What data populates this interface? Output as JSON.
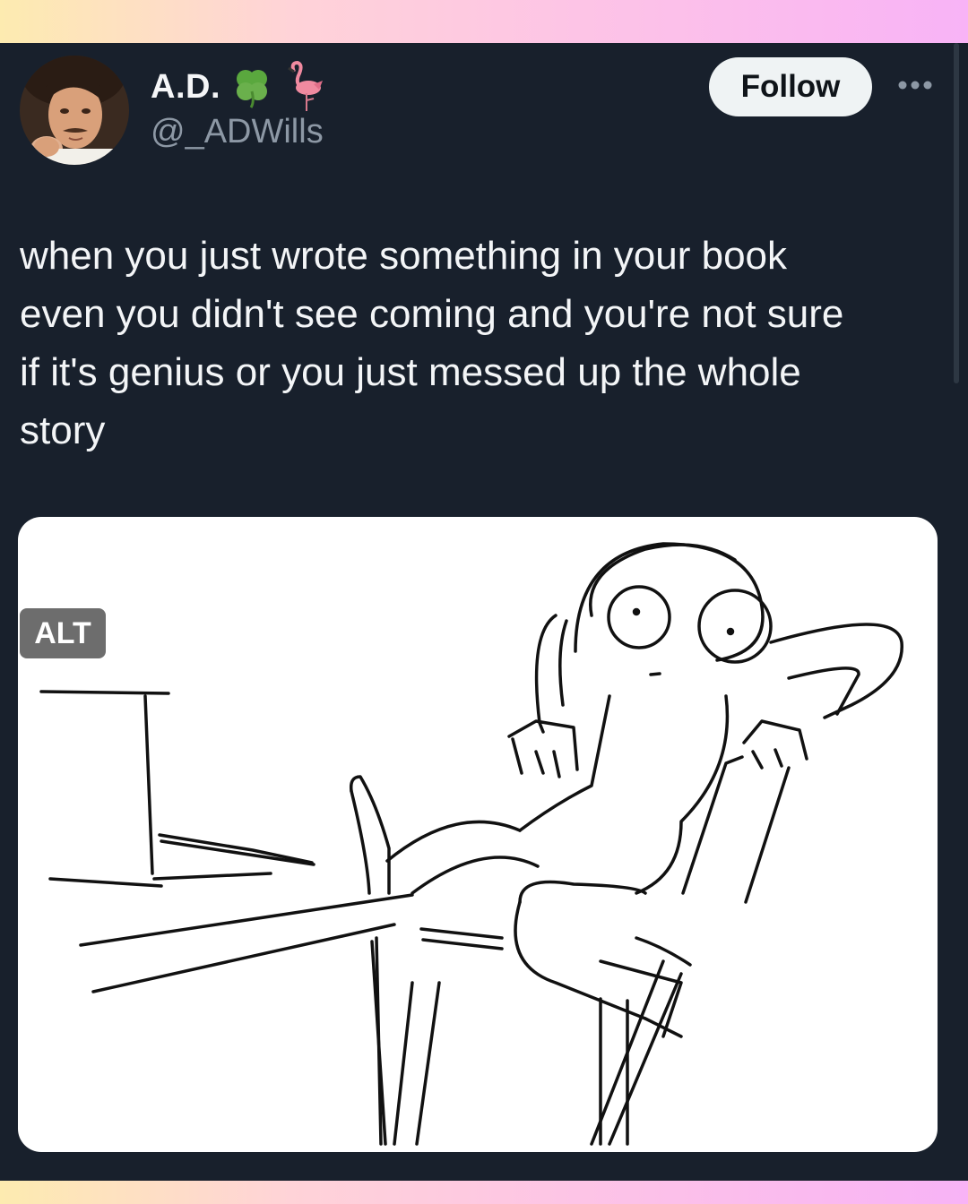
{
  "author": {
    "display_name": "A.D.",
    "handle": "@_ADWills",
    "name_emojis": [
      "clover-icon",
      "flamingo-icon"
    ]
  },
  "follow_label": "Follow",
  "post_text": "when you just wrote something in your book\neven you didn't see coming and you're not sure\nif it's genius or you just messed up the whole\nstory",
  "media": {
    "alt_label": "ALT"
  },
  "colors": {
    "background": "#18202c",
    "text": "#f3f5f7",
    "muted_text": "#8d98a5",
    "follow_button_bg": "#eff3f4",
    "clover": "#6ab04c",
    "flamingo": "#f08aa0"
  }
}
